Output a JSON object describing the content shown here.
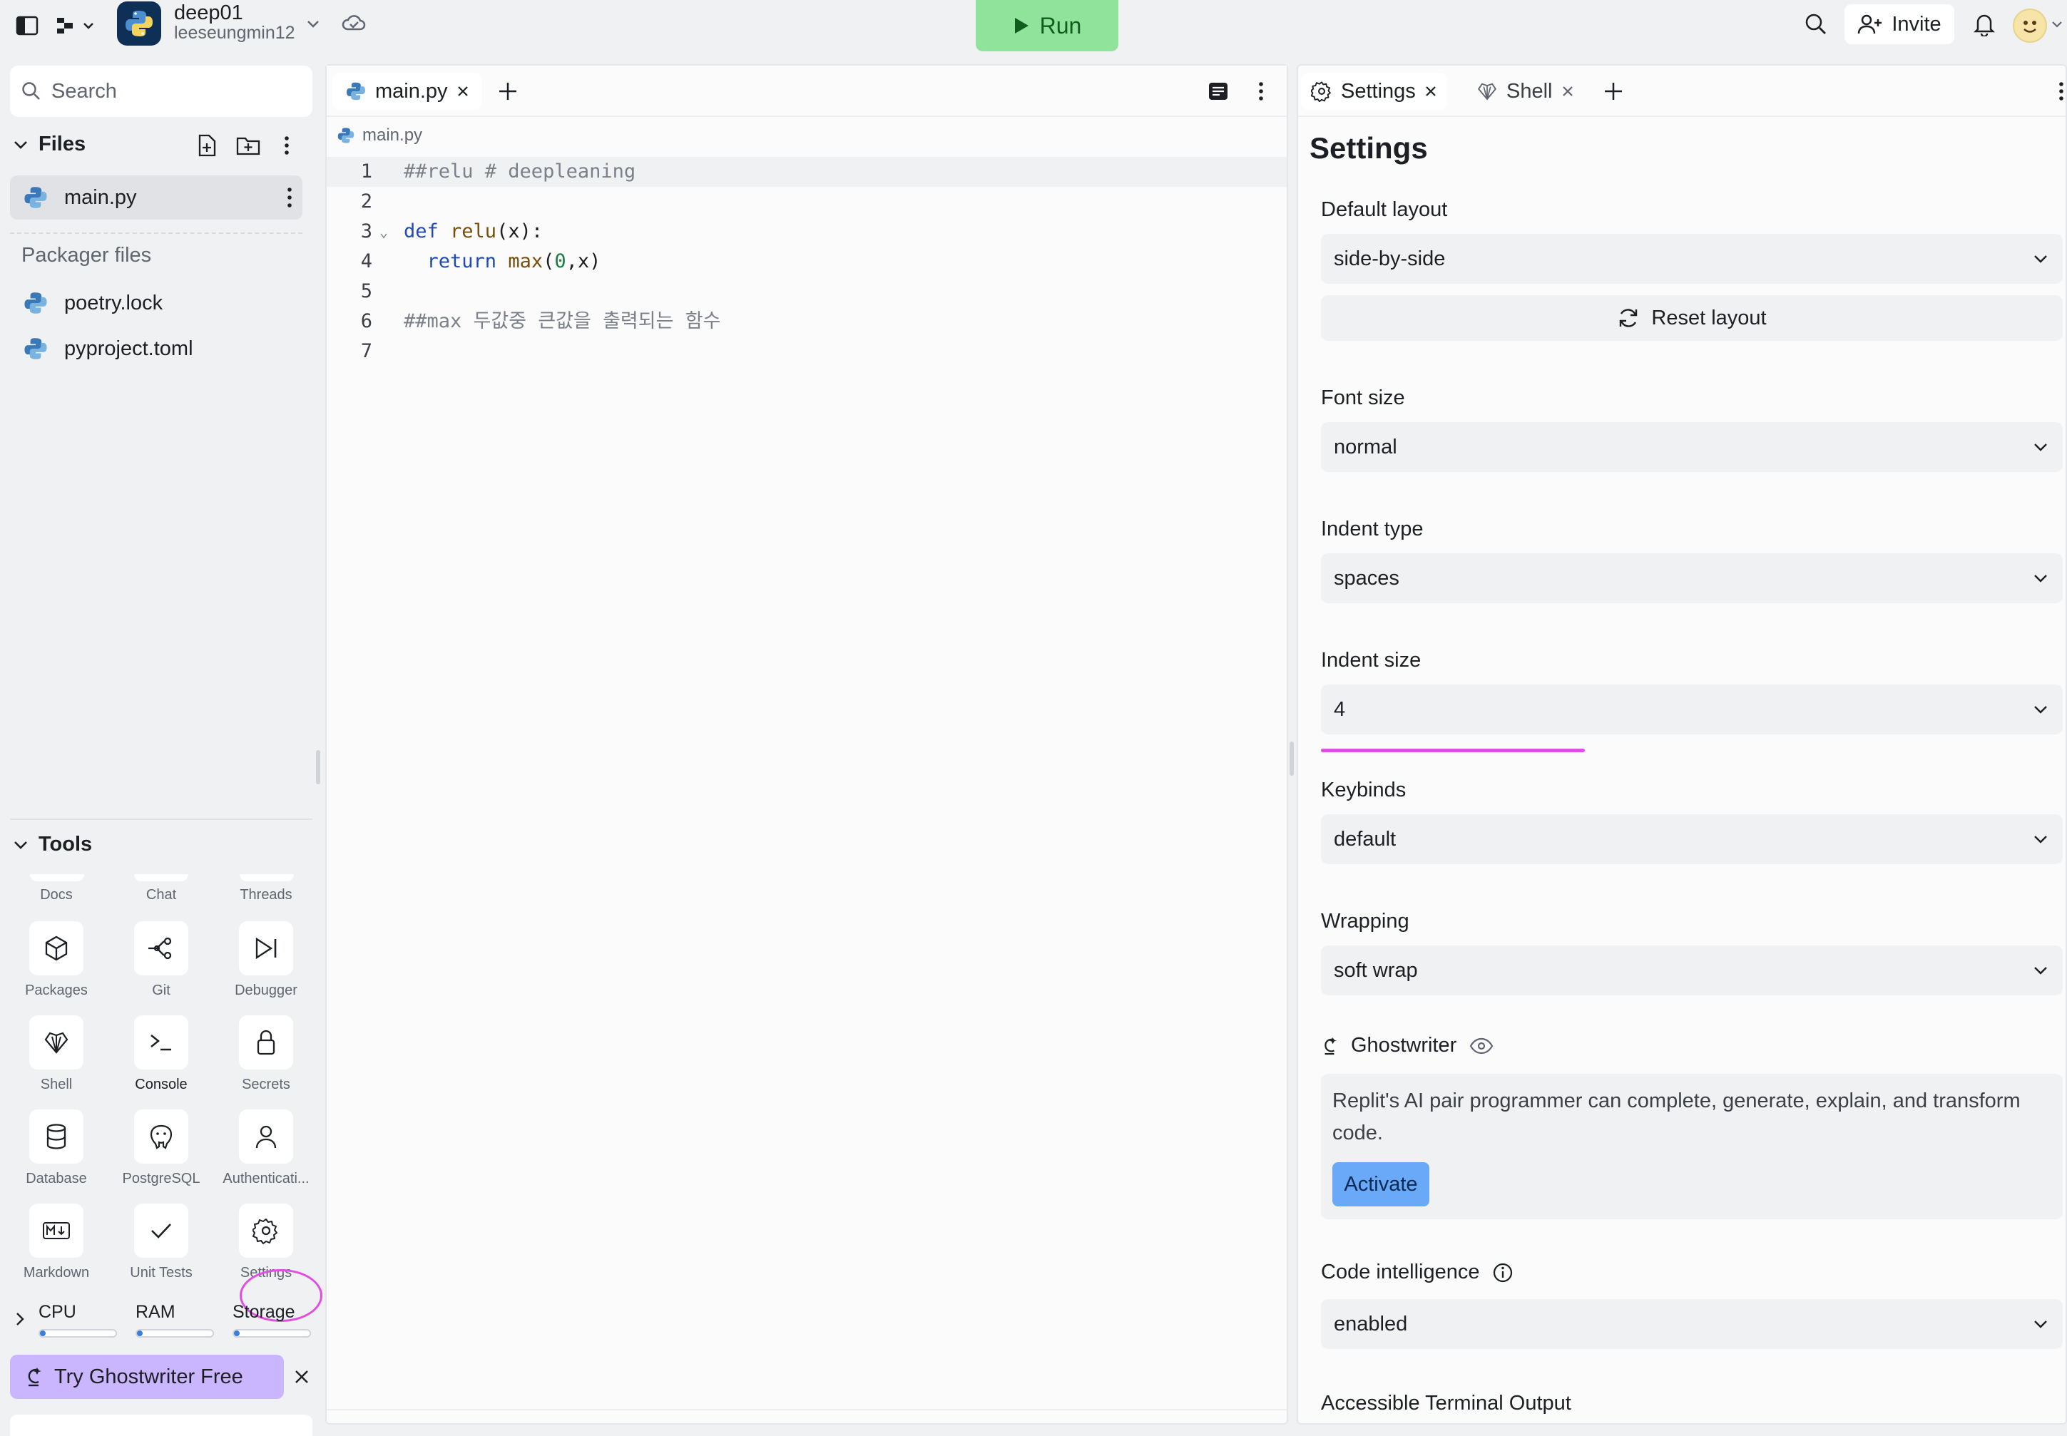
{
  "repl": {
    "name": "deep01",
    "owner": "leeseungmin12"
  },
  "header": {
    "run_label": "Run",
    "invite_label": "Invite"
  },
  "sidebar": {
    "search_placeholder": "Search",
    "files_title": "Files",
    "files": [
      {
        "name": "main.py"
      }
    ],
    "packager_title": "Packager files",
    "packager_files": [
      {
        "name": "poetry.lock"
      },
      {
        "name": "pyproject.toml"
      }
    ],
    "tools_title": "Tools",
    "tools_partial_row": [
      "Docs",
      "Chat",
      "Threads"
    ],
    "tools": [
      {
        "label": "Packages",
        "icon": "package-icon"
      },
      {
        "label": "Git",
        "icon": "git-icon"
      },
      {
        "label": "Debugger",
        "icon": "debugger-icon"
      },
      {
        "label": "Shell",
        "icon": "shell-icon"
      },
      {
        "label": "Console",
        "icon": "console-icon"
      },
      {
        "label": "Secrets",
        "icon": "lock-icon"
      },
      {
        "label": "Database",
        "icon": "database-icon"
      },
      {
        "label": "PostgreSQL",
        "icon": "postgresql-icon"
      },
      {
        "label": "Authenticati...",
        "icon": "user-icon"
      },
      {
        "label": "Markdown",
        "icon": "markdown-icon"
      },
      {
        "label": "Unit Tests",
        "icon": "check-icon"
      },
      {
        "label": "Settings",
        "icon": "gear-icon"
      }
    ],
    "resources": [
      {
        "label": "CPU",
        "fraction": 0.02
      },
      {
        "label": "RAM",
        "fraction": 0.06
      },
      {
        "label": "Storage",
        "fraction": 0.06
      }
    ],
    "ghostwriter_banner": "Try Ghostwriter Free"
  },
  "editor": {
    "tab_label": "main.py",
    "breadcrumb": "main.py",
    "lines": [
      {
        "num": "1",
        "tokens": [
          {
            "t": "##relu # deepleaning",
            "c": "c-comment"
          }
        ]
      },
      {
        "num": "2",
        "tokens": []
      },
      {
        "num": "3",
        "fold": true,
        "tokens": [
          {
            "t": "def ",
            "c": "c-kw"
          },
          {
            "t": "relu",
            "c": "c-fn"
          },
          {
            "t": "(x):",
            "c": "c-plain"
          }
        ]
      },
      {
        "num": "4",
        "tokens": [
          {
            "t": "  ",
            "c": "c-plain"
          },
          {
            "t": "return ",
            "c": "c-kw"
          },
          {
            "t": "max",
            "c": "c-fn"
          },
          {
            "t": "(",
            "c": "c-plain"
          },
          {
            "t": "0",
            "c": "c-num"
          },
          {
            "t": ",x)",
            "c": "c-plain"
          }
        ]
      },
      {
        "num": "5",
        "tokens": []
      },
      {
        "num": "6",
        "tokens": [
          {
            "t": "##max 두값중 큰값을 출력되는 함수",
            "c": "c-comment"
          }
        ]
      },
      {
        "num": "7",
        "tokens": []
      }
    ]
  },
  "settings_pane": {
    "tabs": [
      {
        "label": "Settings"
      },
      {
        "label": "Shell"
      }
    ],
    "title": "Settings",
    "default_layout": {
      "label": "Default layout",
      "value": "side-by-side"
    },
    "reset_layout_label": "Reset layout",
    "font_size": {
      "label": "Font size",
      "value": "normal"
    },
    "indent_type": {
      "label": "Indent type",
      "value": "spaces"
    },
    "indent_size": {
      "label": "Indent size",
      "value": "4"
    },
    "keybinds": {
      "label": "Keybinds",
      "value": "default"
    },
    "wrapping": {
      "label": "Wrapping",
      "value": "soft wrap"
    },
    "ghostwriter": {
      "title": "Ghostwriter",
      "description": "Replit's AI pair programmer can complete, generate, explain, and transform code.",
      "activate_label": "Activate"
    },
    "code_intelligence": {
      "label": "Code intelligence",
      "value": "enabled"
    },
    "accessible_terminal_label": "Accessible Terminal Output"
  },
  "colors": {
    "run_button": "#8fe39a",
    "activate_button": "#6aa9f7",
    "ghostwriter_banner": "#c9b6ff",
    "highlight_annotation": "#e14fe0"
  }
}
